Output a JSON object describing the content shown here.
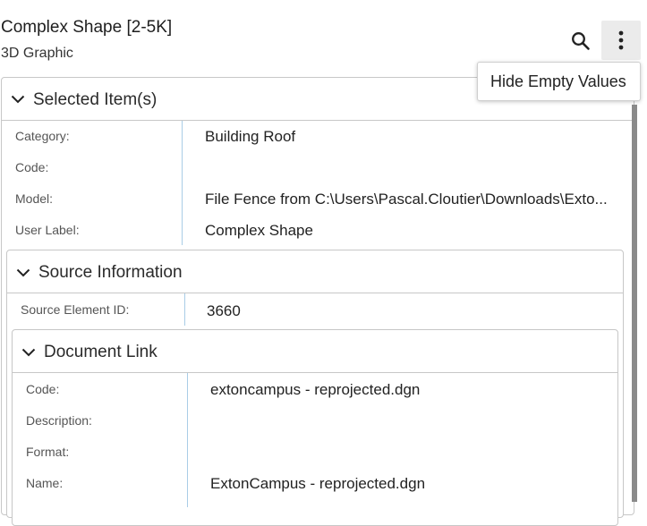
{
  "header": {
    "title": "Complex Shape [2-5K]",
    "subtitle": "3D Graphic"
  },
  "toolbar": {
    "search_icon": "search-icon",
    "more_icon": "more-vertical-icon"
  },
  "menu": {
    "items": [
      {
        "label": "Hide Empty Values"
      }
    ]
  },
  "selected": {
    "title": "Selected Item(s)",
    "rows": [
      {
        "label": "Category:",
        "value": "Building Roof"
      },
      {
        "label": "Code:",
        "value": ""
      },
      {
        "label": "Model:",
        "value": "File Fence from C:\\Users\\Pascal.Cloutier\\Downloads\\Exto..."
      },
      {
        "label": "User Label:",
        "value": "Complex Shape"
      }
    ]
  },
  "source": {
    "title": "Source Information",
    "rows": [
      {
        "label": "Source Element ID:",
        "value": "3660"
      }
    ]
  },
  "doclink": {
    "title": "Document Link",
    "rows": [
      {
        "label": "Code:",
        "value": "extoncampus - reprojected.dgn"
      },
      {
        "label": "Description:",
        "value": ""
      },
      {
        "label": "Format:",
        "value": ""
      },
      {
        "label": "Name:",
        "value": "ExtonCampus - reprojected.dgn"
      }
    ]
  },
  "colors": {
    "separator": "#a9cde6",
    "border": "#c7c7c7",
    "button_bg": "#ebebeb"
  }
}
